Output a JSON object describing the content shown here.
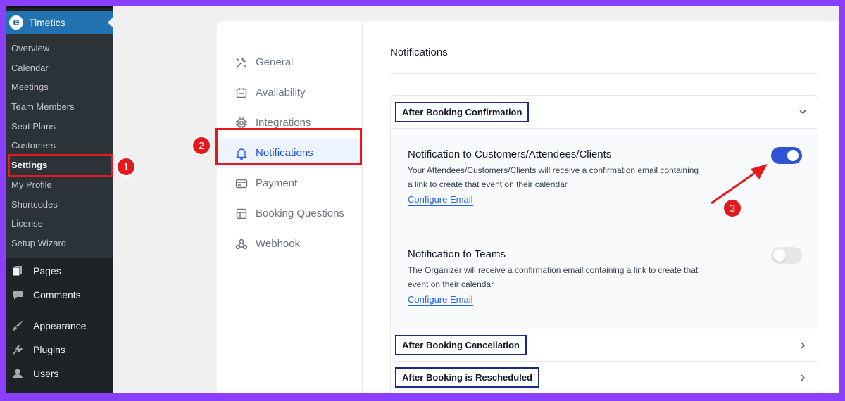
{
  "wp_sidebar": {
    "plugin_title": "Timetics",
    "submenu": [
      "Overview",
      "Calendar",
      "Meetings",
      "Team Members",
      "Seat Plans",
      "Customers",
      "Settings",
      "My Profile",
      "Shortcodes",
      "License",
      "Setup Wizard"
    ],
    "active_submenu": "Settings",
    "main_menu": [
      {
        "label": "Pages",
        "icon": "pages-icon"
      },
      {
        "label": "Comments",
        "icon": "comments-icon"
      },
      {
        "label": "Appearance",
        "icon": "appearance-icon"
      },
      {
        "label": "Plugins",
        "icon": "plugins-icon"
      },
      {
        "label": "Users",
        "icon": "users-icon"
      }
    ]
  },
  "settings_nav": [
    {
      "label": "General",
      "icon": "tools-icon"
    },
    {
      "label": "Availability",
      "icon": "calendar-icon"
    },
    {
      "label": "Integrations",
      "icon": "chip-icon"
    },
    {
      "label": "Notifications",
      "icon": "bell-icon",
      "active": true
    },
    {
      "label": "Payment",
      "icon": "card-icon"
    },
    {
      "label": "Booking Questions",
      "icon": "form-icon"
    },
    {
      "label": "Webhook",
      "icon": "webhook-icon"
    }
  ],
  "content": {
    "heading": "Notifications",
    "sections": [
      {
        "title": "After Booking Confirmation",
        "expanded": true,
        "notifications": [
          {
            "title": "Notification to Customers/Attendees/Clients",
            "description": "Your Attendees/Customers/Clients will receive a confirmation email containing a link to create that event on their calendar",
            "link": "Configure Email",
            "enabled": true
          },
          {
            "title": "Notification to Teams",
            "description": "The Organizer will receive a confirmation email containing a link to create that event on their calendar",
            "link": "Configure Email",
            "enabled": false
          }
        ]
      },
      {
        "title": "After Booking Cancellation",
        "expanded": false
      },
      {
        "title": "After Booking is Rescheduled",
        "expanded": false
      }
    ]
  },
  "annotations": {
    "step1": "1",
    "step2": "2",
    "step3": "3"
  },
  "colors": {
    "wp_sidebar": "#1d2327",
    "wp_accent": "#2271b1",
    "active_nav": "#2563eb",
    "toggle_on": "#2f53d6",
    "annotation_red": "#e3191b",
    "section_box": "#1a2a8a",
    "page_frame": "#8a3ffc"
  }
}
